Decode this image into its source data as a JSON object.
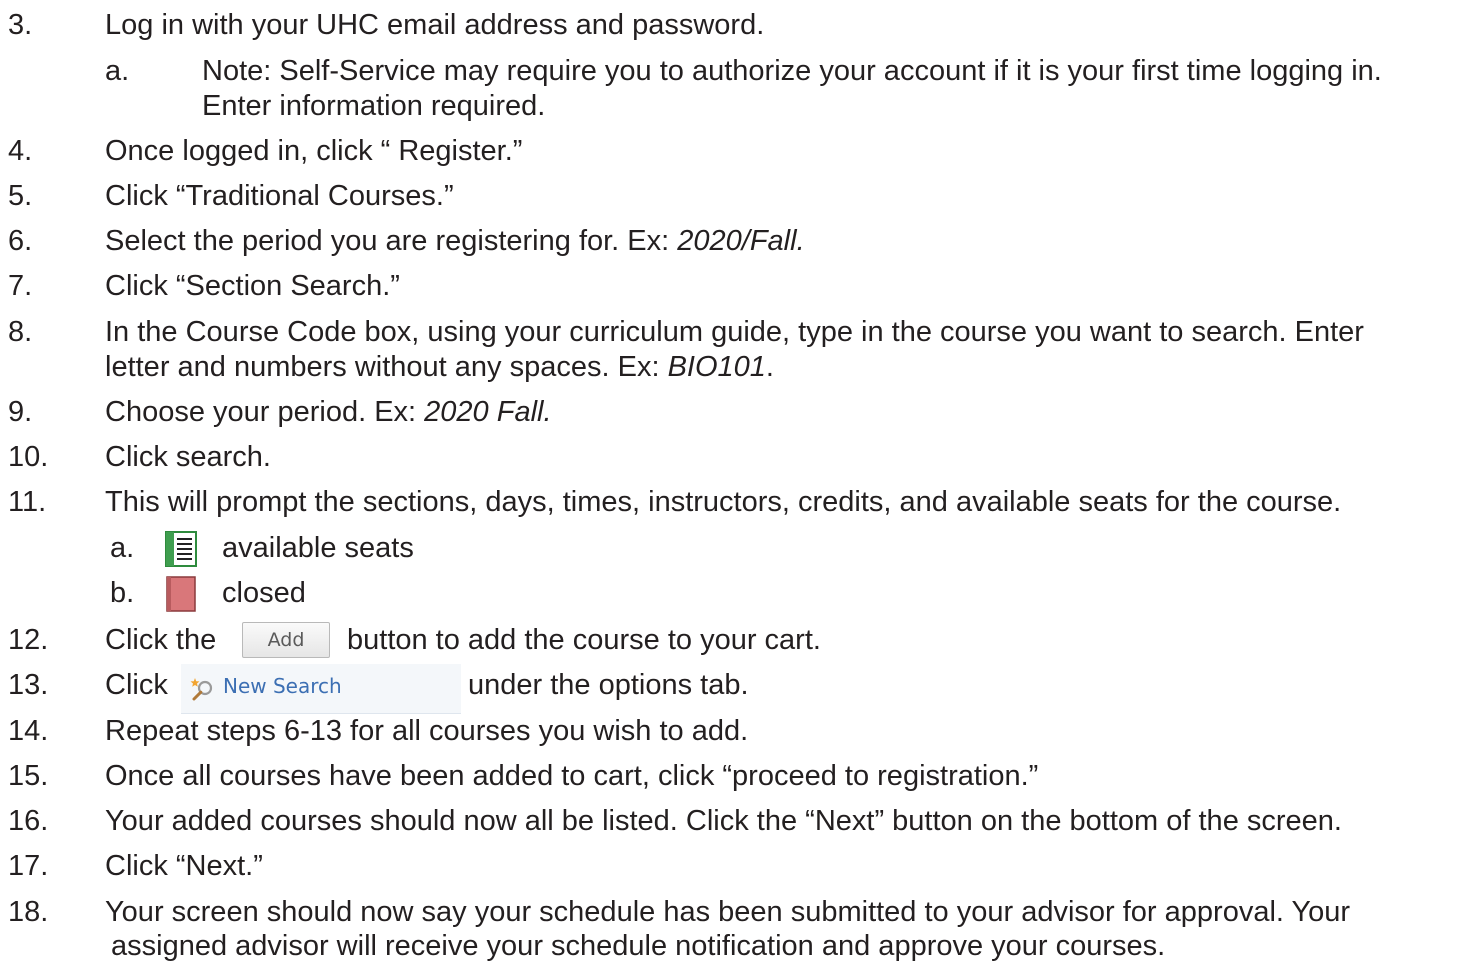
{
  "steps": {
    "s3": {
      "num": "3.",
      "text": "Log in with your UHC email address and password."
    },
    "s3a": {
      "letter": "a.",
      "line1": "Note: Self-Service may require you to authorize your account if it is your first time logging in.",
      "line2": "Enter information required."
    },
    "s4": {
      "num": "4.",
      "text": "Once logged in, click “ Register.”"
    },
    "s5": {
      "num": "5.",
      "text": "Click “Traditional Courses.”"
    },
    "s6": {
      "num": "6.",
      "text": "Select the period you are registering for. Ex: ",
      "example": "2020/Fall."
    },
    "s7": {
      "num": "7.",
      "text": "Click “Section Search.”"
    },
    "s8": {
      "num": "8.",
      "line1": "In the Course Code box, using your curriculum guide, type in the course you want to search. Enter",
      "line2": "letter and numbers without any spaces. Ex: ",
      "example": "BIO101",
      "tail": "."
    },
    "s9": {
      "num": "9.",
      "text": "Choose your period. Ex: ",
      "example": "2020 Fall."
    },
    "s10": {
      "num": "10.",
      "text": "Click search."
    },
    "s11": {
      "num": "11.",
      "text": "This will prompt the sections, days, times, instructors, credits, and available seats for the course."
    },
    "s11a": {
      "letter": "a.",
      "label": "available seats",
      "icon": "open-book-icon",
      "color": "#2e8b3d"
    },
    "s11b": {
      "letter": "b.",
      "label": "closed",
      "icon": "closed-book-icon",
      "color": "#d9777a"
    },
    "s12": {
      "num": "12.",
      "before": "Click the",
      "button": "Add",
      "after": "button to add the course to your cart."
    },
    "s13": {
      "num": "13.",
      "before": "Click",
      "link": "New Search",
      "icon": "new-search-icon",
      "after": "under the options tab."
    },
    "s14": {
      "num": "14.",
      "text": "Repeat steps 6-13 for all courses you wish to add."
    },
    "s15": {
      "num": "15.",
      "text": "Once all courses have been added to cart, click “proceed to registration.”"
    },
    "s16": {
      "num": "16.",
      "text": "Your added courses should now all be listed. Click the “Next” button on the bottom of the screen."
    },
    "s17": {
      "num": "17.",
      "text": "Click “Next.”"
    },
    "s18": {
      "num": "18.",
      "line1": "Your screen should now say your schedule has been submitted to your advisor for approval. Your",
      "line2": "assigned advisor will receive your schedule notification and approve your courses."
    }
  }
}
